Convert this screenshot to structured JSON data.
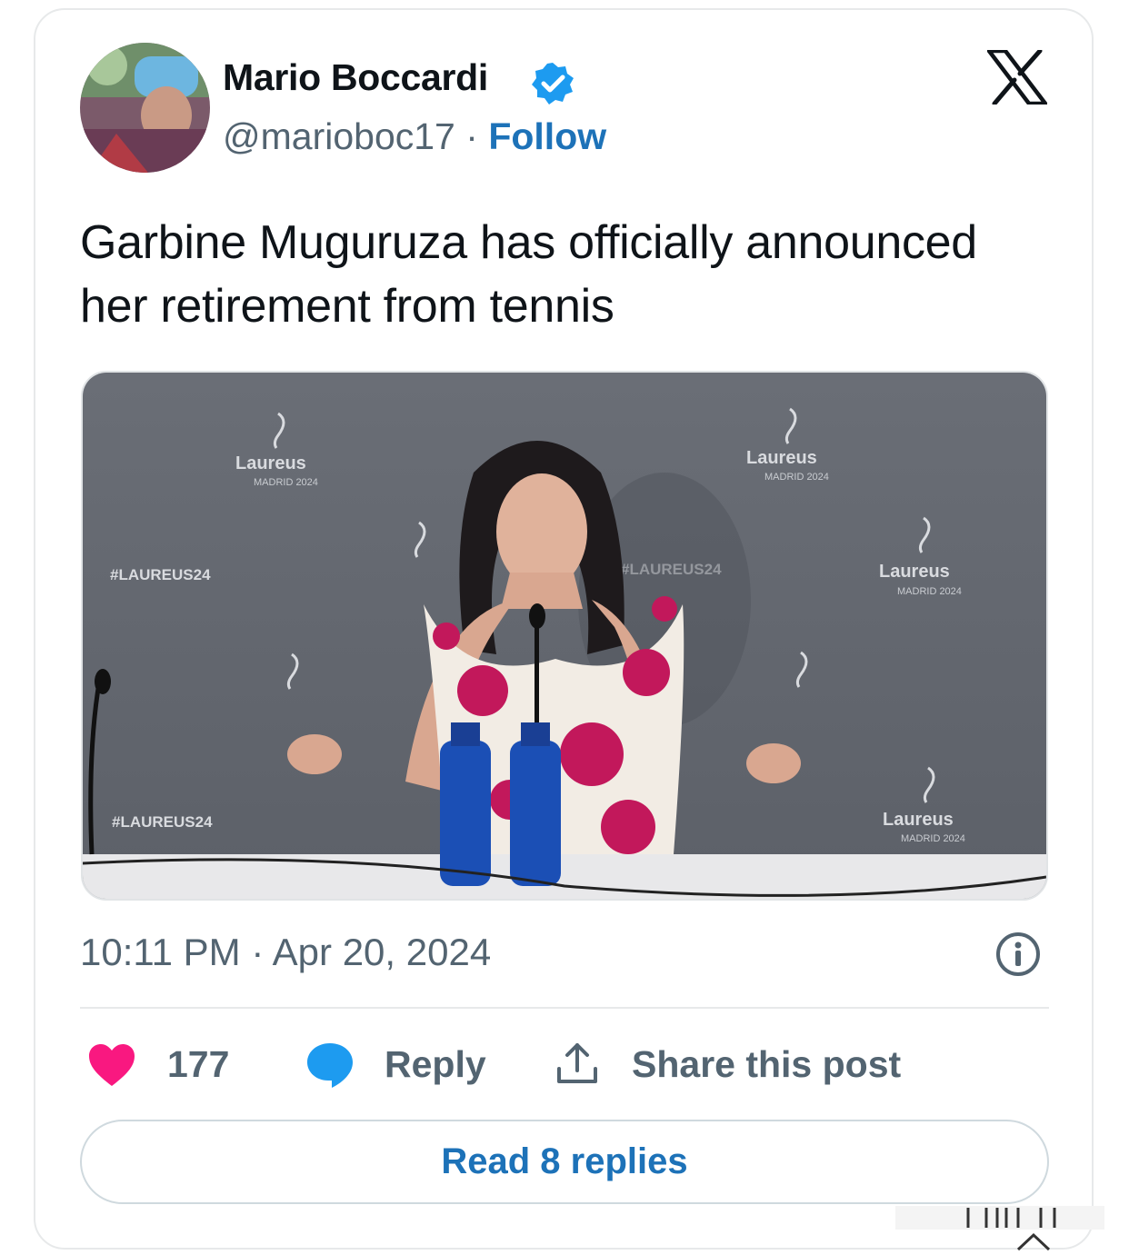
{
  "author": {
    "name": "Mario Boccardi",
    "handle": "@marioboc17",
    "separator": "·",
    "follow_label": "Follow",
    "verified": true,
    "avatar_icon": "avatar-photo"
  },
  "tweet": {
    "text": "Garbine Muguruza has officially announced her retirement from tennis",
    "timestamp": "10:11 PM · Apr 20, 2024"
  },
  "media": {
    "backdrop_text": [
      "#LAUREUS24",
      "#LAUREUS24",
      "#LAUREUS24",
      "Laureus",
      "MADRID 2024"
    ],
    "icon": "press-conference-photo"
  },
  "actions": {
    "like_count": "177",
    "reply_label": "Reply",
    "share_label": "Share this post"
  },
  "replies_button": "Read 8 replies",
  "colors": {
    "link": "#1d72b8",
    "heart": "#f91880",
    "verified": "#1d9bf0",
    "muted": "#536471",
    "border": "#e7e9ea"
  }
}
